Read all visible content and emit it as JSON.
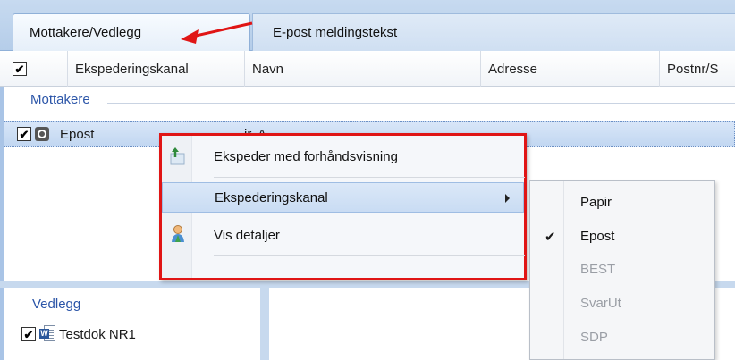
{
  "tabs": [
    {
      "label": "Mottakere/Vedlegg",
      "active": true
    },
    {
      "label": "E-post meldingstekst",
      "active": false
    }
  ],
  "grid": {
    "select_all_checked": true,
    "columns": [
      "Ekspederingskanal",
      "Navn",
      "Adresse",
      "Postnr/S"
    ]
  },
  "recipients": {
    "group_label": "Mottakere",
    "rows": [
      {
        "checked": true,
        "channel_icon": "globe-icon",
        "channel": "Epost",
        "name_fragment": "ir. A"
      }
    ]
  },
  "attachments": {
    "group_label": "Vedlegg",
    "items": [
      {
        "checked": true,
        "icon": "word-document-icon",
        "name": "Testdok NR1"
      }
    ]
  },
  "context_menu": {
    "items": [
      {
        "icon": "preview-send-icon",
        "label": "Ekspeder med forhåndsvisning"
      },
      {
        "label": "Ekspederingskanal",
        "has_submenu": true,
        "highlighted": true
      },
      {
        "icon": "user-details-icon",
        "label": "Vis detaljer"
      }
    ]
  },
  "submenu": {
    "items": [
      {
        "label": "Papir",
        "checked": false,
        "enabled": true
      },
      {
        "label": "Epost",
        "checked": true,
        "enabled": true
      },
      {
        "label": "BEST",
        "checked": false,
        "enabled": false
      },
      {
        "label": "SvarUt",
        "checked": false,
        "enabled": false
      },
      {
        "label": "SDP",
        "checked": false,
        "enabled": false
      }
    ]
  },
  "colors": {
    "annotation_red": "#e01515",
    "group_label_blue": "#2b55a8",
    "selection_blue": "#c2d7f1"
  }
}
